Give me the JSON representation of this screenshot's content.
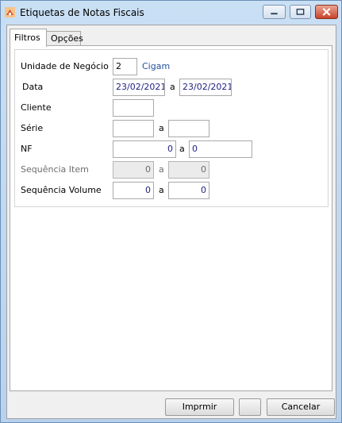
{
  "window": {
    "title": "Etiquetas de Notas Fiscais"
  },
  "tabs": [
    {
      "label": "Filtros"
    },
    {
      "label": "Opções"
    }
  ],
  "form": {
    "unidade": {
      "label": "Unidade de Negócio",
      "code": "2",
      "name": "Cigam"
    },
    "data": {
      "label": "Data",
      "from": "23/02/2021",
      "sep": "a",
      "to": "23/02/2021"
    },
    "cliente": {
      "label": "Cliente",
      "value": ""
    },
    "serie": {
      "label": "Série",
      "from": "",
      "sep": "a",
      "to": ""
    },
    "nf": {
      "label": "NF",
      "from": "0",
      "sep": "a",
      "to": "0"
    },
    "seq_item": {
      "label": "Sequência Item",
      "from": "0",
      "sep": "a",
      "to": "0"
    },
    "seq_volume": {
      "label": "Sequência Volume",
      "from": "0",
      "sep": "a",
      "to": "0"
    }
  },
  "buttons": {
    "print": "Imprmir",
    "blank": "",
    "cancel": "Cancelar"
  },
  "colors": {
    "accent_text": "#1f4f9c",
    "close_button": "#c9432a"
  }
}
